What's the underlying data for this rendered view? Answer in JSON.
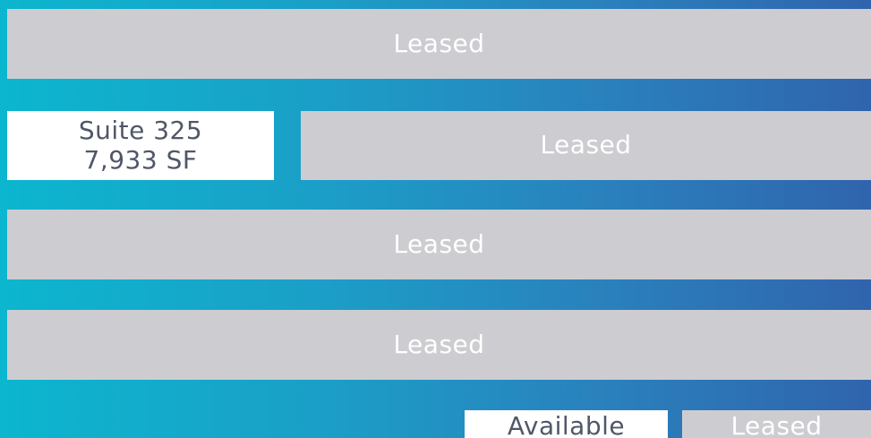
{
  "floors": [
    {
      "units": [
        {
          "status": "Leased"
        }
      ]
    },
    {
      "units": [
        {
          "suite": "Suite 325",
          "size": "7,933 SF"
        },
        {
          "status": "Leased"
        }
      ]
    },
    {
      "units": [
        {
          "status": "Leased"
        }
      ]
    },
    {
      "units": [
        {
          "status": "Leased"
        }
      ]
    },
    {
      "units": [
        {
          "status": "Available"
        },
        {
          "status": "Leased"
        }
      ]
    }
  ],
  "colors": {
    "leased_fill": "#cdcdd1",
    "available_fill": "#ffffff",
    "available_text": "#4f5868",
    "gradient_start": "#0cb6cf",
    "gradient_end": "#3064ad"
  }
}
